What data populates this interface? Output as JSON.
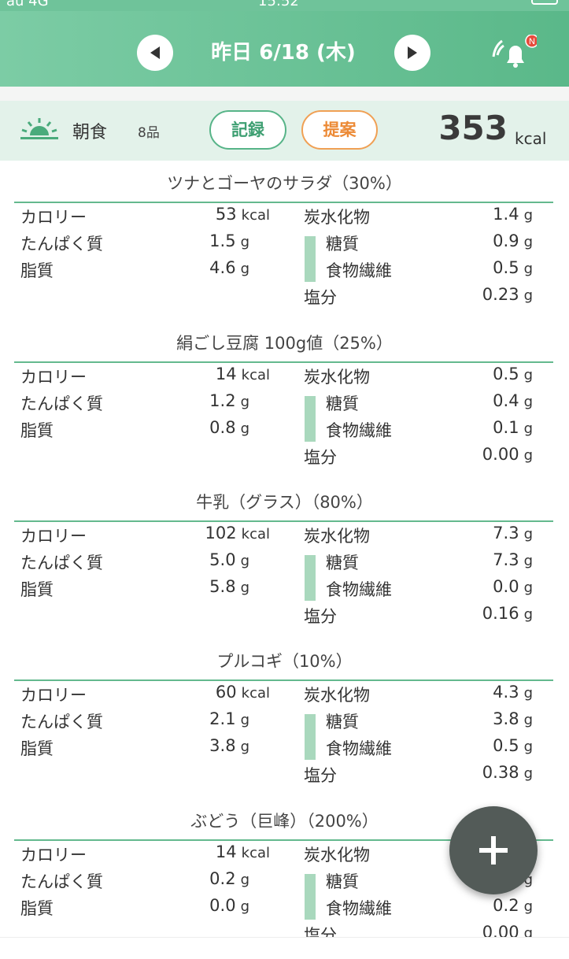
{
  "status": {
    "carrier": "au 4G",
    "time": "15:52"
  },
  "header": {
    "date": "昨日 6/18 (木)",
    "notify_badge": "N",
    "accent": "#5ab889"
  },
  "meal": {
    "name": "朝食",
    "count": "8品",
    "record_label": "記録",
    "suggest_label": "提案",
    "kcal": "353",
    "kcal_unit": "kcal"
  },
  "labels": {
    "calorie": "カロリー",
    "protein": "たんぱく質",
    "fat": "脂質",
    "carb": "炭水化物",
    "sugar": "糖質",
    "fiber": "食物繊維",
    "salt": "塩分"
  },
  "foods": [
    {
      "title": "ツナとゴーヤのサラダ（30%）",
      "calorie": "53",
      "protein": "1.5",
      "fat": "4.6",
      "carb": "1.4",
      "sugar": "0.9",
      "fiber": "0.5",
      "salt": "0.23"
    },
    {
      "title": "絹ごし豆腐 100g値（25%）",
      "calorie": "14",
      "protein": "1.2",
      "fat": "0.8",
      "carb": "0.5",
      "sugar": "0.4",
      "fiber": "0.1",
      "salt": "0.00"
    },
    {
      "title": "牛乳（グラス）（80%）",
      "calorie": "102",
      "protein": "5.0",
      "fat": "5.8",
      "carb": "7.3",
      "sugar": "7.3",
      "fiber": "0.0",
      "salt": "0.16"
    },
    {
      "title": "プルコギ（10%）",
      "calorie": "60",
      "protein": "2.1",
      "fat": "3.8",
      "carb": "4.3",
      "sugar": "3.8",
      "fiber": "0.5",
      "salt": "0.38"
    },
    {
      "title": "ぶどう（巨峰）（200%）",
      "calorie": "14",
      "protein": "0.2",
      "fat": "0.0",
      "carb": "",
      "sugar": "",
      "fiber": "0.2",
      "salt": "0.00"
    }
  ],
  "units": {
    "kcal": "kcal",
    "g": "g"
  }
}
